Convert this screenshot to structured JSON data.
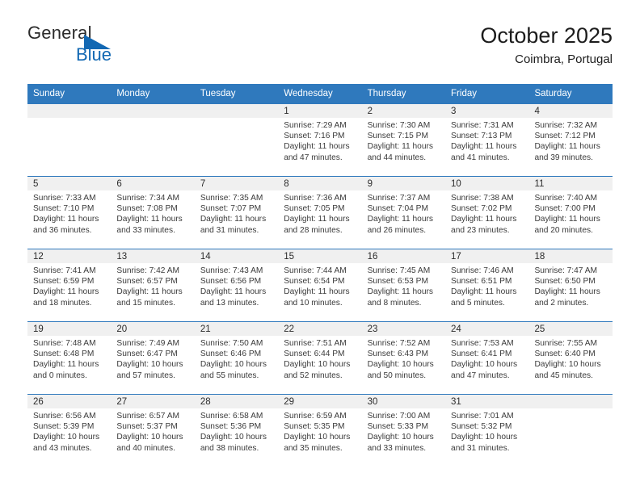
{
  "brand": {
    "name_top": "General",
    "name_bottom": "Blue",
    "accent_color": "#1268b3"
  },
  "header": {
    "title": "October 2025",
    "subtitle": "Coimbra, Portugal"
  },
  "theme": {
    "header_row_bg": "#2f79bd",
    "day_band_bg": "#f0f0f0",
    "text_color": "#2b2b2b"
  },
  "weekdays": [
    "Sunday",
    "Monday",
    "Tuesday",
    "Wednesday",
    "Thursday",
    "Friday",
    "Saturday"
  ],
  "weeks": [
    [
      {
        "day": "",
        "sunrise": "",
        "sunset": "",
        "daylight_line1": "",
        "daylight_line2": ""
      },
      {
        "day": "",
        "sunrise": "",
        "sunset": "",
        "daylight_line1": "",
        "daylight_line2": ""
      },
      {
        "day": "",
        "sunrise": "",
        "sunset": "",
        "daylight_line1": "",
        "daylight_line2": ""
      },
      {
        "day": "1",
        "sunrise": "Sunrise: 7:29 AM",
        "sunset": "Sunset: 7:16 PM",
        "daylight_line1": "Daylight: 11 hours",
        "daylight_line2": "and 47 minutes."
      },
      {
        "day": "2",
        "sunrise": "Sunrise: 7:30 AM",
        "sunset": "Sunset: 7:15 PM",
        "daylight_line1": "Daylight: 11 hours",
        "daylight_line2": "and 44 minutes."
      },
      {
        "day": "3",
        "sunrise": "Sunrise: 7:31 AM",
        "sunset": "Sunset: 7:13 PM",
        "daylight_line1": "Daylight: 11 hours",
        "daylight_line2": "and 41 minutes."
      },
      {
        "day": "4",
        "sunrise": "Sunrise: 7:32 AM",
        "sunset": "Sunset: 7:12 PM",
        "daylight_line1": "Daylight: 11 hours",
        "daylight_line2": "and 39 minutes."
      }
    ],
    [
      {
        "day": "5",
        "sunrise": "Sunrise: 7:33 AM",
        "sunset": "Sunset: 7:10 PM",
        "daylight_line1": "Daylight: 11 hours",
        "daylight_line2": "and 36 minutes."
      },
      {
        "day": "6",
        "sunrise": "Sunrise: 7:34 AM",
        "sunset": "Sunset: 7:08 PM",
        "daylight_line1": "Daylight: 11 hours",
        "daylight_line2": "and 33 minutes."
      },
      {
        "day": "7",
        "sunrise": "Sunrise: 7:35 AM",
        "sunset": "Sunset: 7:07 PM",
        "daylight_line1": "Daylight: 11 hours",
        "daylight_line2": "and 31 minutes."
      },
      {
        "day": "8",
        "sunrise": "Sunrise: 7:36 AM",
        "sunset": "Sunset: 7:05 PM",
        "daylight_line1": "Daylight: 11 hours",
        "daylight_line2": "and 28 minutes."
      },
      {
        "day": "9",
        "sunrise": "Sunrise: 7:37 AM",
        "sunset": "Sunset: 7:04 PM",
        "daylight_line1": "Daylight: 11 hours",
        "daylight_line2": "and 26 minutes."
      },
      {
        "day": "10",
        "sunrise": "Sunrise: 7:38 AM",
        "sunset": "Sunset: 7:02 PM",
        "daylight_line1": "Daylight: 11 hours",
        "daylight_line2": "and 23 minutes."
      },
      {
        "day": "11",
        "sunrise": "Sunrise: 7:40 AM",
        "sunset": "Sunset: 7:00 PM",
        "daylight_line1": "Daylight: 11 hours",
        "daylight_line2": "and 20 minutes."
      }
    ],
    [
      {
        "day": "12",
        "sunrise": "Sunrise: 7:41 AM",
        "sunset": "Sunset: 6:59 PM",
        "daylight_line1": "Daylight: 11 hours",
        "daylight_line2": "and 18 minutes."
      },
      {
        "day": "13",
        "sunrise": "Sunrise: 7:42 AM",
        "sunset": "Sunset: 6:57 PM",
        "daylight_line1": "Daylight: 11 hours",
        "daylight_line2": "and 15 minutes."
      },
      {
        "day": "14",
        "sunrise": "Sunrise: 7:43 AM",
        "sunset": "Sunset: 6:56 PM",
        "daylight_line1": "Daylight: 11 hours",
        "daylight_line2": "and 13 minutes."
      },
      {
        "day": "15",
        "sunrise": "Sunrise: 7:44 AM",
        "sunset": "Sunset: 6:54 PM",
        "daylight_line1": "Daylight: 11 hours",
        "daylight_line2": "and 10 minutes."
      },
      {
        "day": "16",
        "sunrise": "Sunrise: 7:45 AM",
        "sunset": "Sunset: 6:53 PM",
        "daylight_line1": "Daylight: 11 hours",
        "daylight_line2": "and 8 minutes."
      },
      {
        "day": "17",
        "sunrise": "Sunrise: 7:46 AM",
        "sunset": "Sunset: 6:51 PM",
        "daylight_line1": "Daylight: 11 hours",
        "daylight_line2": "and 5 minutes."
      },
      {
        "day": "18",
        "sunrise": "Sunrise: 7:47 AM",
        "sunset": "Sunset: 6:50 PM",
        "daylight_line1": "Daylight: 11 hours",
        "daylight_line2": "and 2 minutes."
      }
    ],
    [
      {
        "day": "19",
        "sunrise": "Sunrise: 7:48 AM",
        "sunset": "Sunset: 6:48 PM",
        "daylight_line1": "Daylight: 11 hours",
        "daylight_line2": "and 0 minutes."
      },
      {
        "day": "20",
        "sunrise": "Sunrise: 7:49 AM",
        "sunset": "Sunset: 6:47 PM",
        "daylight_line1": "Daylight: 10 hours",
        "daylight_line2": "and 57 minutes."
      },
      {
        "day": "21",
        "sunrise": "Sunrise: 7:50 AM",
        "sunset": "Sunset: 6:46 PM",
        "daylight_line1": "Daylight: 10 hours",
        "daylight_line2": "and 55 minutes."
      },
      {
        "day": "22",
        "sunrise": "Sunrise: 7:51 AM",
        "sunset": "Sunset: 6:44 PM",
        "daylight_line1": "Daylight: 10 hours",
        "daylight_line2": "and 52 minutes."
      },
      {
        "day": "23",
        "sunrise": "Sunrise: 7:52 AM",
        "sunset": "Sunset: 6:43 PM",
        "daylight_line1": "Daylight: 10 hours",
        "daylight_line2": "and 50 minutes."
      },
      {
        "day": "24",
        "sunrise": "Sunrise: 7:53 AM",
        "sunset": "Sunset: 6:41 PM",
        "daylight_line1": "Daylight: 10 hours",
        "daylight_line2": "and 47 minutes."
      },
      {
        "day": "25",
        "sunrise": "Sunrise: 7:55 AM",
        "sunset": "Sunset: 6:40 PM",
        "daylight_line1": "Daylight: 10 hours",
        "daylight_line2": "and 45 minutes."
      }
    ],
    [
      {
        "day": "26",
        "sunrise": "Sunrise: 6:56 AM",
        "sunset": "Sunset: 5:39 PM",
        "daylight_line1": "Daylight: 10 hours",
        "daylight_line2": "and 43 minutes."
      },
      {
        "day": "27",
        "sunrise": "Sunrise: 6:57 AM",
        "sunset": "Sunset: 5:37 PM",
        "daylight_line1": "Daylight: 10 hours",
        "daylight_line2": "and 40 minutes."
      },
      {
        "day": "28",
        "sunrise": "Sunrise: 6:58 AM",
        "sunset": "Sunset: 5:36 PM",
        "daylight_line1": "Daylight: 10 hours",
        "daylight_line2": "and 38 minutes."
      },
      {
        "day": "29",
        "sunrise": "Sunrise: 6:59 AM",
        "sunset": "Sunset: 5:35 PM",
        "daylight_line1": "Daylight: 10 hours",
        "daylight_line2": "and 35 minutes."
      },
      {
        "day": "30",
        "sunrise": "Sunrise: 7:00 AM",
        "sunset": "Sunset: 5:33 PM",
        "daylight_line1": "Daylight: 10 hours",
        "daylight_line2": "and 33 minutes."
      },
      {
        "day": "31",
        "sunrise": "Sunrise: 7:01 AM",
        "sunset": "Sunset: 5:32 PM",
        "daylight_line1": "Daylight: 10 hours",
        "daylight_line2": "and 31 minutes."
      },
      {
        "day": "",
        "sunrise": "",
        "sunset": "",
        "daylight_line1": "",
        "daylight_line2": ""
      }
    ]
  ]
}
